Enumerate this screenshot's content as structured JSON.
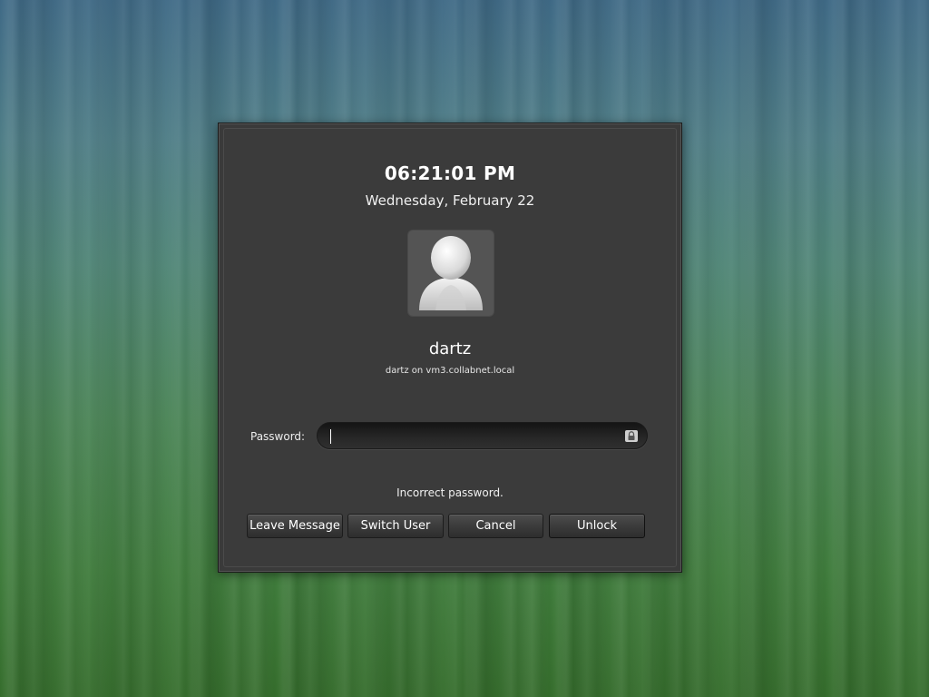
{
  "screensaver": {
    "time": "06:21:01 PM",
    "date": "Wednesday, February 22",
    "avatar_icon": "user-avatar-icon",
    "username": "dartz",
    "hostline": "dartz on vm3.collabnet.local",
    "password": {
      "label": "Password:",
      "value": "",
      "lock_icon": "padlock-icon"
    },
    "status_message": "Incorrect password.",
    "buttons": {
      "leave_message": "Leave Message",
      "switch_user": "Switch User",
      "cancel": "Cancel",
      "unlock": "Unlock"
    }
  },
  "colors": {
    "dialog_background": "#3a3a3a",
    "text": "#ffffff",
    "desktop_top": "#3f6a86",
    "desktop_bottom": "#356d2c"
  }
}
